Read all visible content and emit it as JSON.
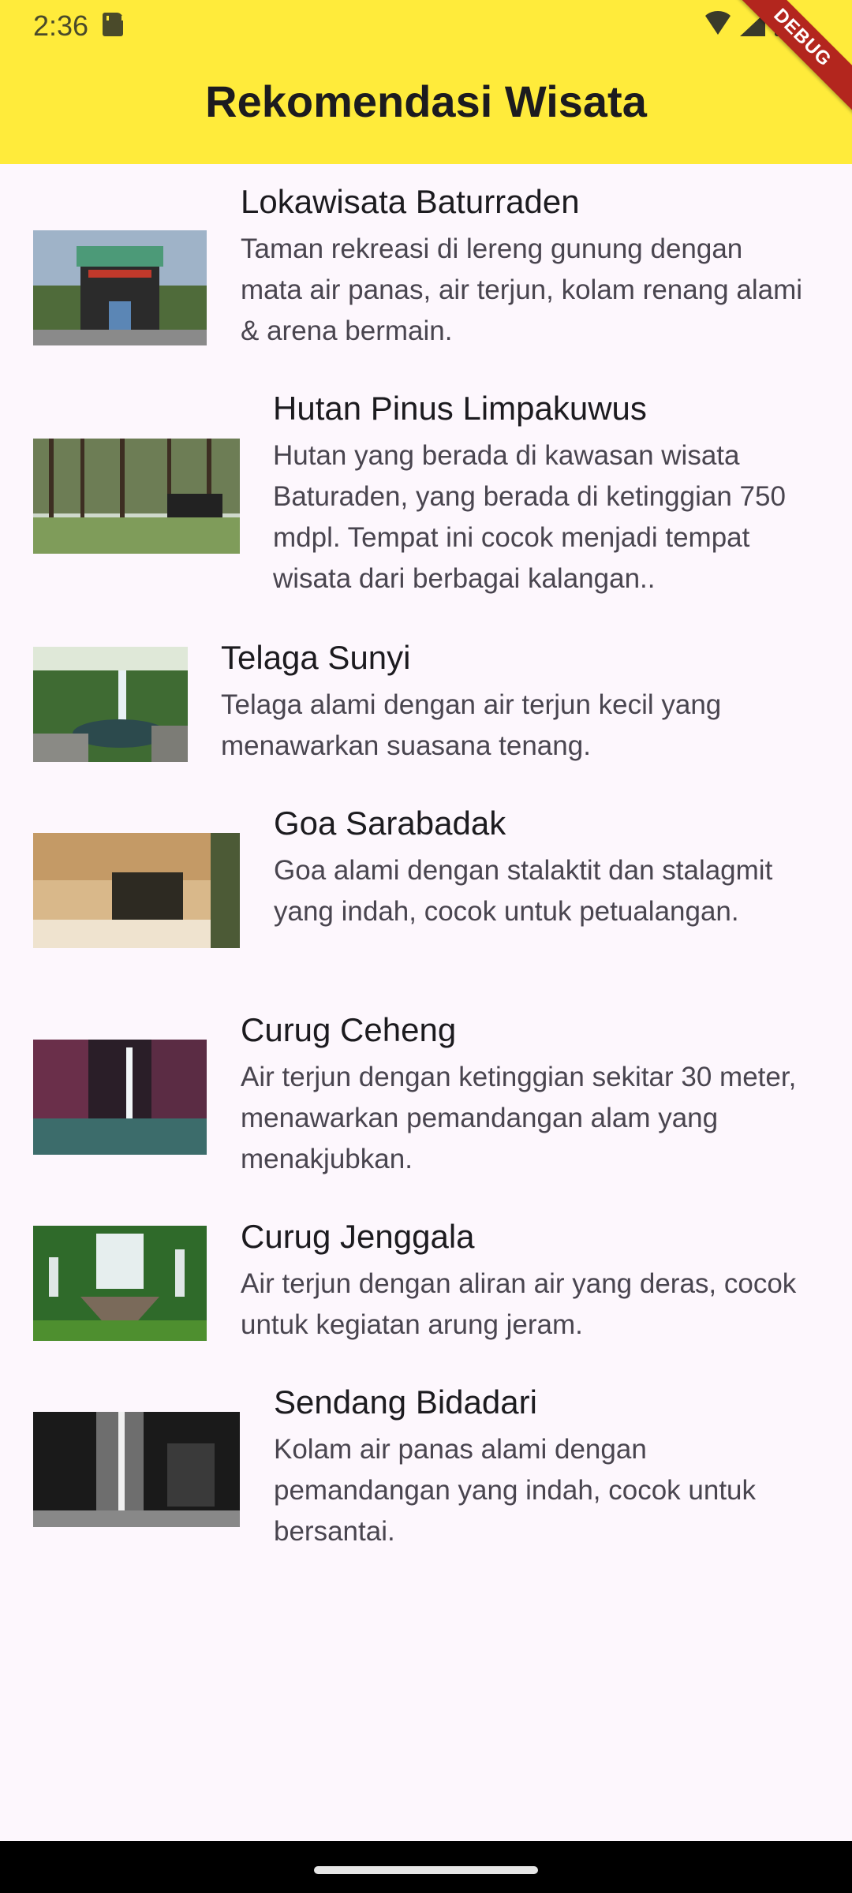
{
  "status": {
    "time": "2:36"
  },
  "debug_label": "DEBUG",
  "app_bar": {
    "title": "Rekomendasi Wisata",
    "color": "#ffeb3b"
  },
  "places": [
    {
      "title": "Lokawisata Baturraden",
      "description": "Taman rekreasi di lereng gunung dengan mata air panas, air terjun, kolam renang alami & arena bermain."
    },
    {
      "title": "Hutan Pinus Limpakuwus",
      "description": "Hutan yang berada di kawasan wisata Baturaden, yang berada di ketinggian 750 mdpl. Tempat ini cocok menjadi tempat wisata dari berbagai kalangan.."
    },
    {
      "title": "Telaga Sunyi",
      "description": "Telaga alami dengan air terjun kecil yang menawarkan suasana tenang."
    },
    {
      "title": "Goa Sarabadak",
      "description": "Goa alami dengan stalaktit dan stalagmit yang indah, cocok untuk petualangan."
    },
    {
      "title": "Curug Ceheng",
      "description": "Air terjun dengan ketinggian sekitar 30 meter, menawarkan pemandangan alam yang menakjubkan."
    },
    {
      "title": "Curug Jenggala",
      "description": "Air terjun dengan aliran air yang deras, cocok untuk kegiatan arung jeram."
    },
    {
      "title": "Sendang Bidadari",
      "description": "Kolam air panas alami dengan pemandangan yang indah, cocok untuk bersantai."
    }
  ]
}
